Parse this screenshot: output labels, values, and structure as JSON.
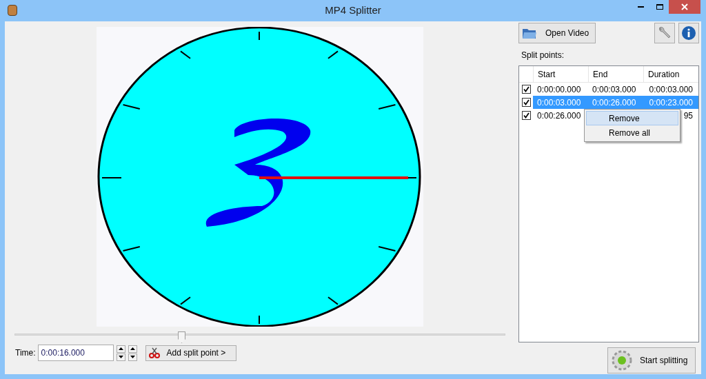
{
  "window": {
    "title": "MP4 Splitter"
  },
  "seek": {
    "level": 0.34
  },
  "time": {
    "label": "Time:",
    "value": "0:00:16.000"
  },
  "add_button": {
    "label": "Add split point >"
  },
  "open_button": {
    "label": "Open Video"
  },
  "split_label": "Split points:",
  "table": {
    "columns": [
      "Start",
      "End",
      "Duration"
    ],
    "rows": [
      {
        "checked": true,
        "selected": false,
        "start": "0:00:00.000",
        "end": "0:00:03.000",
        "duration": "0:00:03.000"
      },
      {
        "checked": true,
        "selected": true,
        "start": "0:00:03.000",
        "end": "0:00:26.000",
        "duration": "0:00:23.000"
      },
      {
        "checked": true,
        "selected": false,
        "start": "0:00:26.000",
        "duration": "95"
      }
    ]
  },
  "context_menu": [
    {
      "label": "Remove",
      "selected": true
    },
    {
      "label": "Remove all",
      "selected": false
    }
  ],
  "start_button": {
    "label": "Start splitting"
  }
}
